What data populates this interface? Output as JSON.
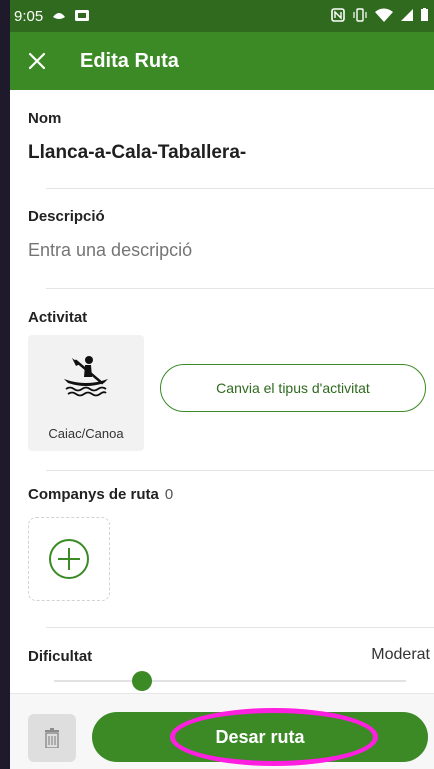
{
  "status_bar": {
    "time": "9:05",
    "left_icons": [
      "eye-drop-icon",
      "cast-icon"
    ],
    "right_icons": [
      "nfc-icon",
      "vibrate-icon",
      "wifi-icon",
      "signal-icon",
      "battery-icon"
    ]
  },
  "app_bar": {
    "title": "Edita Ruta",
    "close_icon": "close-icon"
  },
  "form": {
    "name_label": "Nom",
    "name_value": "Llanca-a-Cala-Taballera-",
    "description_label": "Descripció",
    "description_placeholder": "Entra una descripció",
    "activity_label": "Activitat",
    "activity_name": "Caiac/Canoa",
    "activity_icon": "kayak-icon",
    "change_activity_button": "Canvia el tipus d'activitat",
    "companions_label": "Companys de ruta",
    "companions_count": "0",
    "add_companion_icon": "plus-circle-icon",
    "difficulty_label": "Dificultat",
    "difficulty_value": "Moderat",
    "difficulty_level_fraction": 0.25
  },
  "bottom_bar": {
    "delete_icon": "trash-icon",
    "save_button": "Desar ruta"
  },
  "colors": {
    "primary": "#3b8a26",
    "status_bar": "#2f6a1e",
    "highlight": "#ff1fe0"
  }
}
